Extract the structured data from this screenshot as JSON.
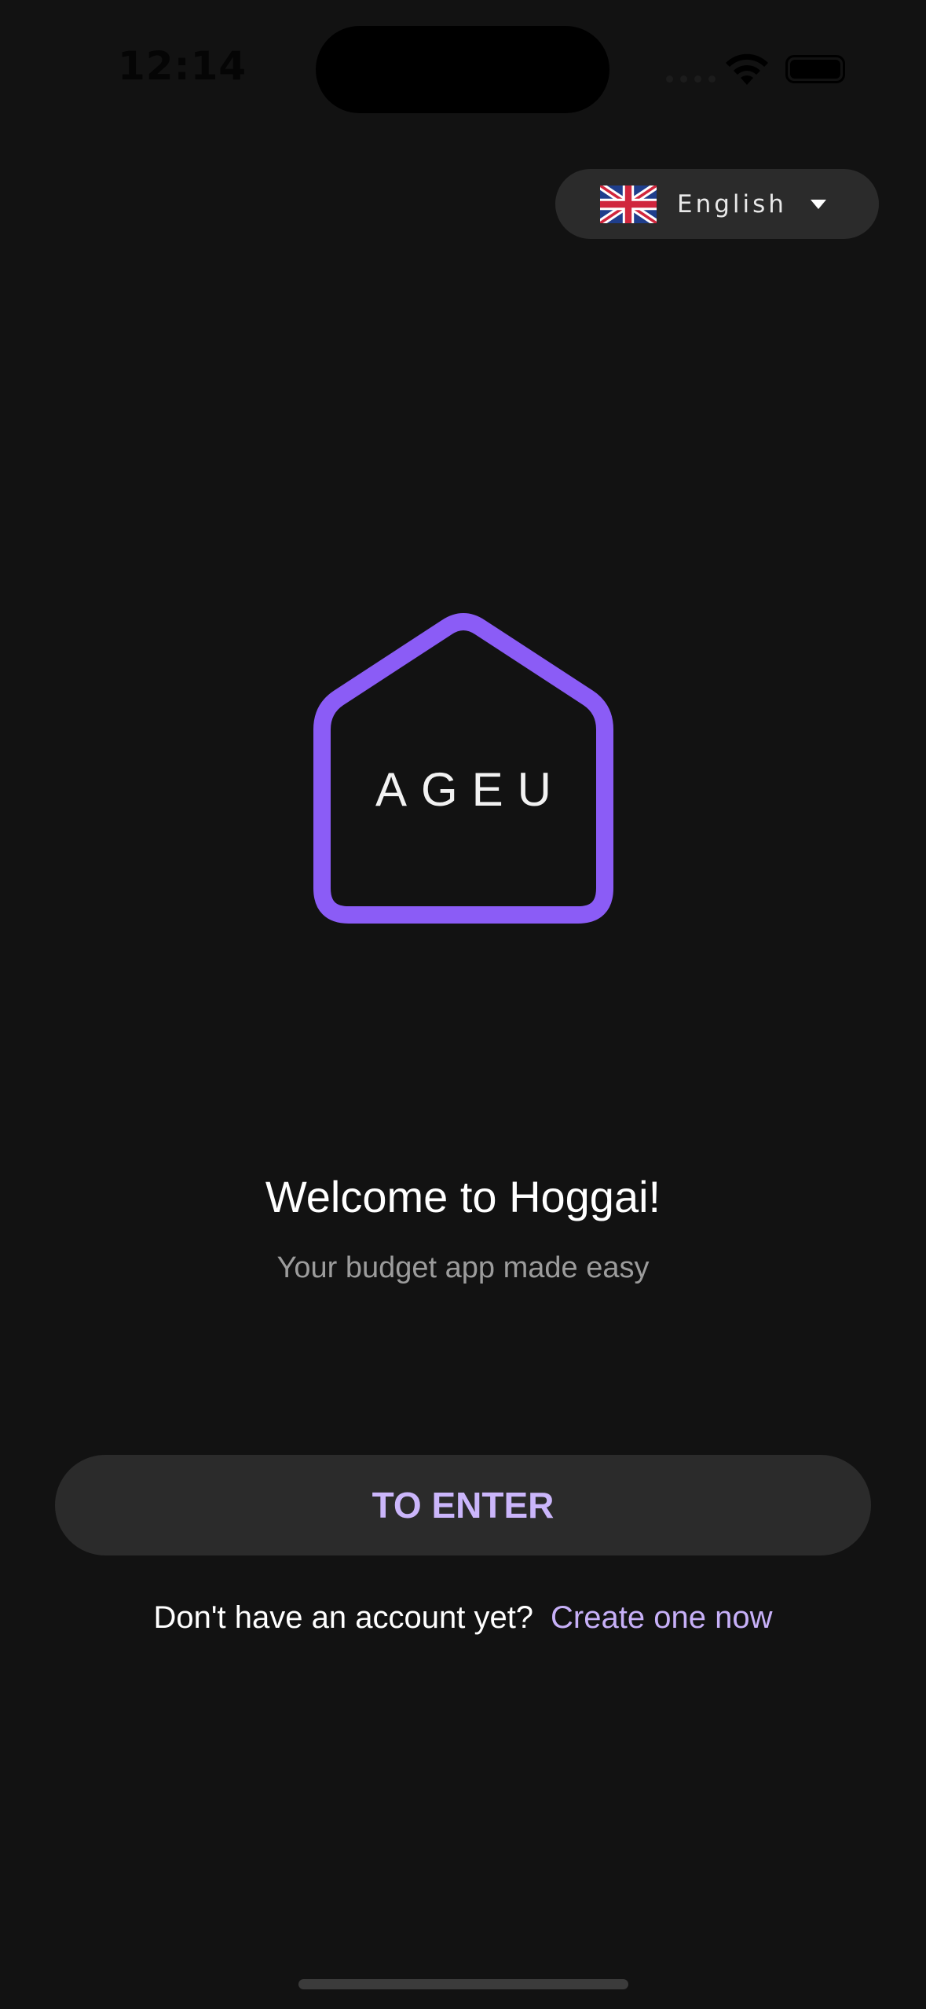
{
  "status_bar": {
    "time": "12:14"
  },
  "language_selector": {
    "label": "English",
    "flag": "uk-flag-icon"
  },
  "logo": {
    "text": "AGEU",
    "accent_color": "#8b5cf6"
  },
  "welcome": {
    "title": "Welcome to Hoggai!",
    "subtitle": "Your budget app made easy"
  },
  "enter_button": {
    "label": "TO ENTER"
  },
  "signup": {
    "prompt": "Don't have an account yet?",
    "link": "Create one now"
  },
  "colors": {
    "background": "#121212",
    "surface": "#2b2b2b",
    "button_text": "#cbb6fb",
    "link": "#c7b0f8"
  }
}
